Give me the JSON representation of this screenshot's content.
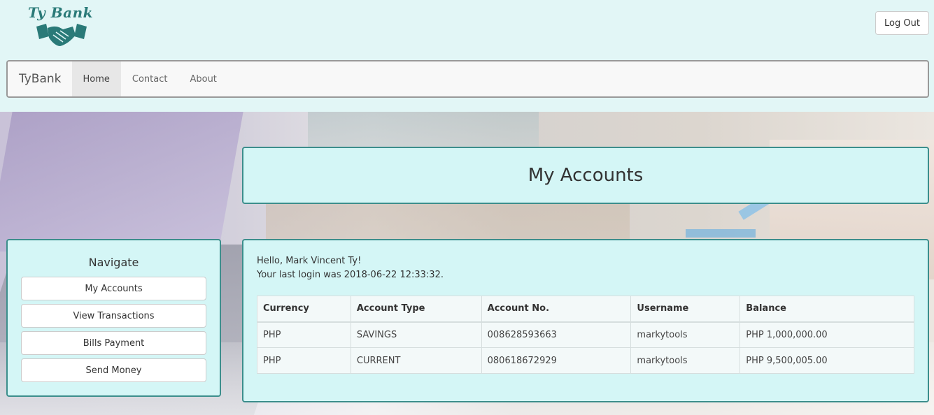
{
  "logo": {
    "text": "Ty Bank",
    "icon": "handshake-icon"
  },
  "header": {
    "logout_label": "Log Out"
  },
  "navbar": {
    "brand": "TyBank",
    "items": [
      {
        "label": "Home",
        "active": true
      },
      {
        "label": "Contact",
        "active": false
      },
      {
        "label": "About",
        "active": false
      }
    ]
  },
  "page": {
    "title": "My Accounts"
  },
  "sidebar": {
    "heading": "Navigate",
    "buttons": [
      {
        "label": "My Accounts"
      },
      {
        "label": "View Transactions"
      },
      {
        "label": "Bills Payment"
      },
      {
        "label": "Send Money"
      }
    ]
  },
  "main": {
    "greeting": "Hello, Mark Vincent Ty!",
    "last_login": "Your last login was 2018-06-22 12:33:32.",
    "table": {
      "columns": [
        "Currency",
        "Account Type",
        "Account No.",
        "Username",
        "Balance"
      ],
      "rows": [
        [
          "PHP",
          "SAVINGS",
          "008628593663",
          "markytools",
          "PHP 1,000,000.00"
        ],
        [
          "PHP",
          "CURRENT",
          "080618672929",
          "markytools",
          "PHP 9,500,005.00"
        ]
      ]
    }
  },
  "colors": {
    "background": "#e2f6f6",
    "panel": "#d4f6f6",
    "panel_border": "#3c8e8c",
    "logo": "#2a7a78"
  }
}
